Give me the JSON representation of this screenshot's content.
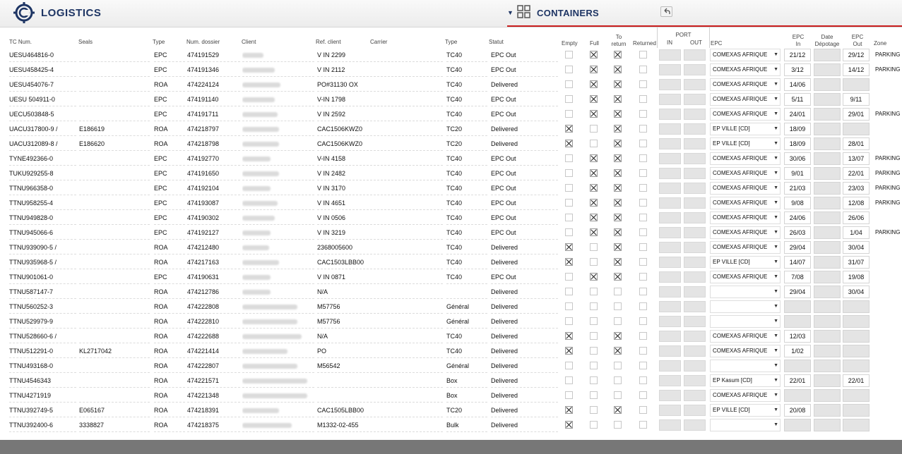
{
  "header": {
    "app_title": "LOGISTICS",
    "section_title": "CONTAINERS",
    "colors": {
      "brand": "#1e3564",
      "accent_line": "#c81e1e"
    }
  },
  "columns": {
    "tc_num": "TC Num.",
    "seals": "Seals",
    "type": "Type",
    "num_dossier": "Num. dossier",
    "client": "Client",
    "ref_client": "Ref. client",
    "carrier": "Carrier",
    "type2": "Type",
    "statut": "Statut",
    "empty": "Empty",
    "full": "Full",
    "to_return_1": "To",
    "to_return_2": "return",
    "returned": "Returned",
    "port": "PORT",
    "port_in": "IN",
    "port_out": "OUT",
    "epc": "EPC",
    "epc_in_1": "EPC",
    "epc_in_2": "In",
    "date_dep_1": "Date",
    "date_dep_2": "Dépotage",
    "epc_out_1": "EPC",
    "epc_out_2": "Out",
    "zone": "Zone"
  },
  "rows": [
    {
      "tc": "UESU464816-0",
      "seals": "",
      "type": "EPC",
      "dossier": "474191529",
      "clientw": 30,
      "ref": "V IN 2299",
      "carrier": "",
      "type2": "TC40",
      "statut": "EPC Out",
      "empty": false,
      "full": true,
      "toret": true,
      "returned": false,
      "epc": "COMEXAS AFRIQUE",
      "epc_in": "21/12",
      "dep": "",
      "epc_out": "29/12",
      "zone": "PARKING"
    },
    {
      "tc": "UESU458425-4",
      "seals": "",
      "type": "EPC",
      "dossier": "474191346",
      "clientw": 46,
      "ref": "V IN 2112",
      "carrier": "",
      "type2": "TC40",
      "statut": "EPC Out",
      "empty": false,
      "full": true,
      "toret": true,
      "returned": false,
      "epc": "COMEXAS AFRIQUE",
      "epc_in": "3/12",
      "dep": "",
      "epc_out": "14/12",
      "zone": "PARKING"
    },
    {
      "tc": "UESU454076-7",
      "seals": "",
      "type": "ROA",
      "dossier": "474224124",
      "clientw": 54,
      "ref": "PO#31130 OX",
      "carrier": "",
      "type2": "TC40",
      "statut": "Delivered",
      "empty": false,
      "full": true,
      "toret": true,
      "returned": false,
      "epc": "COMEXAS AFRIQUE",
      "epc_in": "14/06",
      "dep": "",
      "epc_out": "",
      "zone": ""
    },
    {
      "tc": "UESU 504911-0",
      "seals": "",
      "type": "EPC",
      "dossier": "474191140",
      "clientw": 46,
      "ref": "V-IN 1798",
      "carrier": "",
      "type2": "TC40",
      "statut": "EPC Out",
      "empty": false,
      "full": true,
      "toret": true,
      "returned": false,
      "epc": "COMEXAS AFRIQUE",
      "epc_in": "5/11",
      "dep": "",
      "epc_out": "9/11",
      "zone": ""
    },
    {
      "tc": "UECU503848-5",
      "seals": "",
      "type": "EPC",
      "dossier": "474191711",
      "clientw": 50,
      "ref": "V IN 2592",
      "carrier": "",
      "type2": "TC40",
      "statut": "EPC Out",
      "empty": false,
      "full": true,
      "toret": true,
      "returned": false,
      "epc": "COMEXAS AFRIQUE",
      "epc_in": "24/01",
      "dep": "",
      "epc_out": "29/01",
      "zone": "PARKING"
    },
    {
      "tc": "UACU317800-9 /",
      "seals": "E186619",
      "type": "ROA",
      "dossier": "474218797",
      "clientw": 52,
      "ref": "CAC1506KWZ0",
      "carrier": "",
      "type2": "TC20",
      "statut": "Delivered",
      "empty": true,
      "full": false,
      "toret": true,
      "returned": false,
      "epc": "EP VILLE [CD]",
      "epc_in": "18/09",
      "dep": "",
      "epc_out": "",
      "zone": ""
    },
    {
      "tc": "UACU312089-8 /",
      "seals": "E186620",
      "type": "ROA",
      "dossier": "474218798",
      "clientw": 52,
      "ref": "CAC1506KWZ0",
      "carrier": "",
      "type2": "TC20",
      "statut": "Delivered",
      "empty": true,
      "full": false,
      "toret": true,
      "returned": false,
      "epc": "EP VILLE [CD]",
      "epc_in": "18/09",
      "dep": "",
      "epc_out": "28/01",
      "zone": ""
    },
    {
      "tc": "TYNE492366-0",
      "seals": "",
      "type": "EPC",
      "dossier": "474192770",
      "clientw": 40,
      "ref": "V-IN 4158",
      "carrier": "",
      "type2": "TC40",
      "statut": "EPC Out",
      "empty": false,
      "full": true,
      "toret": true,
      "returned": false,
      "epc": "COMEXAS AFRIQUE",
      "epc_in": "30/06",
      "dep": "",
      "epc_out": "13/07",
      "zone": "PARKING"
    },
    {
      "tc": "TUKU929255-8",
      "seals": "",
      "type": "EPC",
      "dossier": "474191650",
      "clientw": 52,
      "ref": "V IN 2482",
      "carrier": "",
      "type2": "TC40",
      "statut": "EPC Out",
      "empty": false,
      "full": true,
      "toret": true,
      "returned": false,
      "epc": "COMEXAS AFRIQUE",
      "epc_in": "9/01",
      "dep": "",
      "epc_out": "22/01",
      "zone": "PARKING"
    },
    {
      "tc": "TTNU966358-0",
      "seals": "",
      "type": "EPC",
      "dossier": "474192104",
      "clientw": 40,
      "ref": "V IN 3170",
      "carrier": "",
      "type2": "TC40",
      "statut": "EPC Out",
      "empty": false,
      "full": true,
      "toret": true,
      "returned": false,
      "epc": "COMEXAS AFRIQUE",
      "epc_in": "21/03",
      "dep": "",
      "epc_out": "23/03",
      "zone": "PARKING"
    },
    {
      "tc": "TTNU958255-4",
      "seals": "",
      "type": "EPC",
      "dossier": "474193087",
      "clientw": 50,
      "ref": "V IN 4651",
      "carrier": "",
      "type2": "TC40",
      "statut": "EPC Out",
      "empty": false,
      "full": true,
      "toret": true,
      "returned": false,
      "epc": "COMEXAS AFRIQUE",
      "epc_in": "9/08",
      "dep": "",
      "epc_out": "12/08",
      "zone": "PARKING"
    },
    {
      "tc": "TTNU949828-0",
      "seals": "",
      "type": "EPC",
      "dossier": "474190302",
      "clientw": 46,
      "ref": "V IN 0506",
      "carrier": "",
      "type2": "TC40",
      "statut": "EPC Out",
      "empty": false,
      "full": true,
      "toret": true,
      "returned": false,
      "epc": "COMEXAS AFRIQUE",
      "epc_in": "24/06",
      "dep": "",
      "epc_out": "26/06",
      "zone": ""
    },
    {
      "tc": "TTNU945066-6",
      "seals": "",
      "type": "EPC",
      "dossier": "474192127",
      "clientw": 40,
      "ref": "V IN 3219",
      "carrier": "",
      "type2": "TC40",
      "statut": "EPC Out",
      "empty": false,
      "full": true,
      "toret": true,
      "returned": false,
      "epc": "COMEXAS AFRIQUE",
      "epc_in": "26/03",
      "dep": "",
      "epc_out": "1/04",
      "zone": "PARKING"
    },
    {
      "tc": "TTNU939090-5 /",
      "seals": "",
      "type": "ROA",
      "dossier": "474212480",
      "clientw": 38,
      "ref": "2368005600",
      "carrier": "",
      "type2": "TC40",
      "statut": "Delivered",
      "empty": true,
      "full": false,
      "toret": true,
      "returned": false,
      "epc": "COMEXAS AFRIQUE",
      "epc_in": "29/04",
      "dep": "",
      "epc_out": "30/04",
      "zone": ""
    },
    {
      "tc": "TTNU935968-5 /",
      "seals": "",
      "type": "ROA",
      "dossier": "474217163",
      "clientw": 52,
      "ref": "CAC1503LBB00",
      "carrier": "",
      "type2": "TC40",
      "statut": "Delivered",
      "empty": true,
      "full": false,
      "toret": true,
      "returned": false,
      "epc": "EP VILLE [CD]",
      "epc_in": "14/07",
      "dep": "",
      "epc_out": "31/07",
      "zone": ""
    },
    {
      "tc": "TTNU901061-0",
      "seals": "",
      "type": "EPC",
      "dossier": "474190631",
      "clientw": 40,
      "ref": "V IN 0871",
      "carrier": "",
      "type2": "TC40",
      "statut": "EPC Out",
      "empty": false,
      "full": true,
      "toret": true,
      "returned": false,
      "epc": "COMEXAS AFRIQUE",
      "epc_in": "7/08",
      "dep": "",
      "epc_out": "19/08",
      "zone": ""
    },
    {
      "tc": "TTNU587147-7",
      "seals": "",
      "type": "ROA",
      "dossier": "474212786",
      "clientw": 40,
      "ref": "N/A",
      "carrier": "",
      "type2": "",
      "statut": "Delivered",
      "empty": false,
      "full": false,
      "toret": false,
      "returned": false,
      "epc": "",
      "epc_in": "29/04",
      "dep": "",
      "epc_out": "30/04",
      "zone": ""
    },
    {
      "tc": "TTNU560252-3",
      "seals": "",
      "type": "ROA",
      "dossier": "474222808",
      "clientw": 78,
      "ref": "M57756",
      "carrier": "",
      "type2": "Général",
      "statut": "Delivered",
      "empty": false,
      "full": false,
      "toret": false,
      "returned": false,
      "epc": "",
      "epc_in": "",
      "dep": "",
      "epc_out": "",
      "zone": ""
    },
    {
      "tc": "TTNU529979-9",
      "seals": "",
      "type": "ROA",
      "dossier": "474222810",
      "clientw": 78,
      "ref": "M57756",
      "carrier": "",
      "type2": "Général",
      "statut": "Delivered",
      "empty": false,
      "full": false,
      "toret": false,
      "returned": false,
      "epc": "",
      "epc_in": "",
      "dep": "",
      "epc_out": "",
      "zone": ""
    },
    {
      "tc": "TTNU528660-6 /",
      "seals": "",
      "type": "ROA",
      "dossier": "474222688",
      "clientw": 84,
      "ref": "N/A",
      "carrier": "",
      "type2": "TC40",
      "statut": "Delivered",
      "empty": true,
      "full": false,
      "toret": true,
      "returned": false,
      "epc": "COMEXAS AFRIQUE",
      "epc_in": "12/03",
      "dep": "",
      "epc_out": "",
      "zone": ""
    },
    {
      "tc": "TTNU512291-0",
      "seals": "KL2717042",
      "type": "ROA",
      "dossier": "474221414",
      "clientw": 64,
      "ref": "PO",
      "carrier": "",
      "type2": "TC40",
      "statut": "Delivered",
      "empty": true,
      "full": false,
      "toret": true,
      "returned": false,
      "epc": "COMEXAS AFRIQUE",
      "epc_in": "1/02",
      "dep": "",
      "epc_out": "",
      "zone": ""
    },
    {
      "tc": "TTNU493168-0",
      "seals": "",
      "type": "ROA",
      "dossier": "474222807",
      "clientw": 78,
      "ref": "M56542",
      "carrier": "",
      "type2": "Général",
      "statut": "Delivered",
      "empty": false,
      "full": false,
      "toret": false,
      "returned": false,
      "epc": "",
      "epc_in": "",
      "dep": "",
      "epc_out": "",
      "zone": ""
    },
    {
      "tc": "TTNU4546343",
      "seals": "",
      "type": "ROA",
      "dossier": "474221571",
      "clientw": 92,
      "ref": "",
      "carrier": "",
      "type2": "Box",
      "statut": "Delivered",
      "empty": false,
      "full": false,
      "toret": false,
      "returned": false,
      "epc": "EP Kasum [CD]",
      "epc_in": "22/01",
      "dep": "",
      "epc_out": "22/01",
      "zone": ""
    },
    {
      "tc": "TTNU4271919",
      "seals": "",
      "type": "ROA",
      "dossier": "474221348",
      "clientw": 92,
      "ref": "",
      "carrier": "",
      "type2": "Box",
      "statut": "Delivered",
      "empty": false,
      "full": false,
      "toret": false,
      "returned": false,
      "epc": "COMEXAS AFRIQUE",
      "epc_in": "",
      "dep": "",
      "epc_out": "",
      "zone": ""
    },
    {
      "tc": "TTNU392749-5",
      "seals": "E065167",
      "type": "ROA",
      "dossier": "474218391",
      "clientw": 52,
      "ref": "CAC1505LBB00",
      "carrier": "",
      "type2": "TC20",
      "statut": "Delivered",
      "empty": true,
      "full": false,
      "toret": true,
      "returned": false,
      "epc": "EP VILLE [CD]",
      "epc_in": "20/08",
      "dep": "",
      "epc_out": "",
      "zone": ""
    },
    {
      "tc": "TTNU392400-6",
      "seals": "3338827",
      "type": "ROA",
      "dossier": "474218375",
      "clientw": 70,
      "ref": "M1332-02-455",
      "carrier": "",
      "type2": "Bulk",
      "statut": "Delivered",
      "empty": true,
      "full": false,
      "toret": false,
      "returned": false,
      "epc": "",
      "epc_in": "",
      "dep": "",
      "epc_out": "",
      "zone": ""
    }
  ]
}
